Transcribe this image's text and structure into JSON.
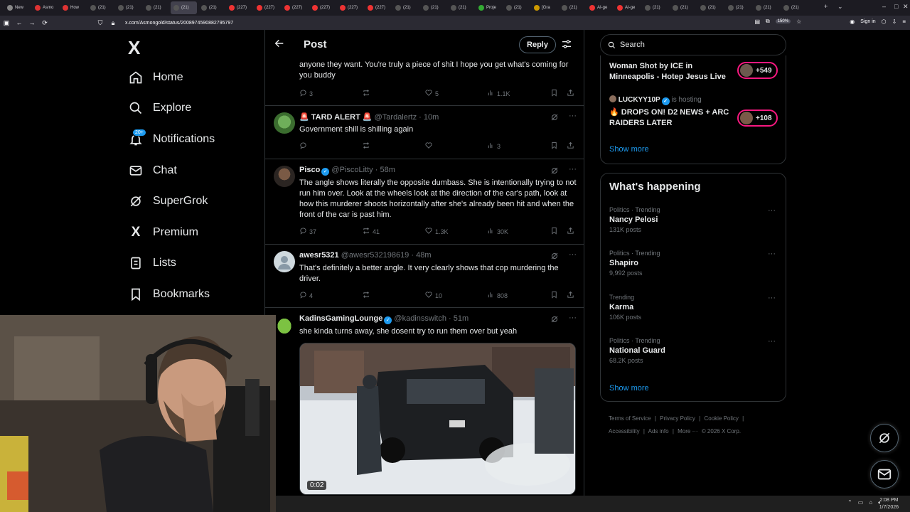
{
  "browser": {
    "tabs": [
      "New",
      "Asmo",
      "How",
      "(21)",
      "(21)",
      "(21)",
      "(21)",
      "(21)",
      "(227)",
      "(227)",
      "(227)",
      "(227)",
      "(227)",
      "(227)",
      "(21)",
      "(21)",
      "(21)",
      "Proje",
      "(21)",
      "[Gra",
      "(21)",
      "AI-ge",
      "AI-ge",
      "(21)",
      "(21)",
      "(21)",
      "(21)",
      "(21)",
      "(21)"
    ],
    "active_tab_index": 6,
    "url": "x.com/Asmongold/status/2008974590882795797",
    "zoom": "150%",
    "sign_in": "Sign in"
  },
  "sidebar": {
    "logo": "X",
    "items": [
      {
        "label": "Home",
        "icon": "home-icon"
      },
      {
        "label": "Explore",
        "icon": "search-icon"
      },
      {
        "label": "Notifications",
        "icon": "bell-icon",
        "badge": "20+"
      },
      {
        "label": "Chat",
        "icon": "mail-icon"
      },
      {
        "label": "SuperGrok",
        "icon": "grok-icon"
      },
      {
        "label": "Premium",
        "icon": "x-icon"
      },
      {
        "label": "Lists",
        "icon": "list-icon"
      },
      {
        "label": "Bookmarks",
        "icon": "bookmark-icon"
      }
    ]
  },
  "header": {
    "title": "Post",
    "reply_label": "Reply"
  },
  "tweets": [
    {
      "text_partial": "anyone they want. You're truly a piece of shit I hope you get what's coming for you buddy",
      "replies": "3",
      "reposts": "",
      "likes": "5",
      "views": "1.1K"
    },
    {
      "name": "🚨 TARD ALERT 🚨",
      "handle": "@Tardalertz",
      "time": "10m",
      "text": "Government shill is shilling again",
      "replies": "",
      "reposts": "",
      "likes": "",
      "views": "3"
    },
    {
      "name": "Pisco",
      "verified": true,
      "handle": "@PiscoLitty",
      "time": "58m",
      "text": "The angle shows literally the opposite dumbass. She is intentionally trying to not run  him over. Look at the wheels look at the direction of the car's path, look at how this murderer shoots horizontally after she's already been hit and when the front of the car is past him.",
      "replies": "37",
      "reposts": "41",
      "likes": "1.3K",
      "views": "30K"
    },
    {
      "name": "awesr5321",
      "handle": "@awesr532198619",
      "time": "48m",
      "text": "That's definitely a better angle. It very clearly shows that cop murdering the driver.",
      "replies": "4",
      "reposts": "",
      "likes": "10",
      "views": "808"
    },
    {
      "name": "KadinsGamingLounge",
      "verified": true,
      "handle": "@kadinsswitch",
      "time": "51m",
      "text": "she kinda turns away, she dosent try to run them over but yeah",
      "video_duration": "0:02"
    }
  ],
  "right": {
    "search_placeholder": "Search",
    "live": [
      {
        "title": "Woman Shot by ICE in Minneapolis - Hotep Jesus Live",
        "viewers": "+549"
      },
      {
        "host": "LUCKYY10P",
        "host_suffix": "is hosting",
        "title": "🔥 DROPS ON! D2 NEWS + ARC RAIDERS LATER",
        "viewers": "+108"
      }
    ],
    "live_show_more": "Show more",
    "whats_happening_title": "What's happening",
    "trends": [
      {
        "context": "Politics · Trending",
        "name": "Nancy Pelosi",
        "count": "131K posts"
      },
      {
        "context": "Politics · Trending",
        "name": "Shapiro",
        "count": "9,992 posts"
      },
      {
        "context": "Trending",
        "name": "Karma",
        "count": "106K posts"
      },
      {
        "context": "Politics · Trending",
        "name": "National Guard",
        "count": "68.2K posts"
      }
    ],
    "trends_show_more": "Show more",
    "footer": [
      "Terms of Service",
      "|",
      "Privacy Policy",
      "|",
      "Cookie Policy",
      "|",
      "Accessibility",
      "|",
      "Ads info",
      "|",
      "More ···",
      "© 2026 X Corp."
    ]
  },
  "taskbar": {
    "time": "2:08 PM",
    "date": "1/7/2026"
  }
}
